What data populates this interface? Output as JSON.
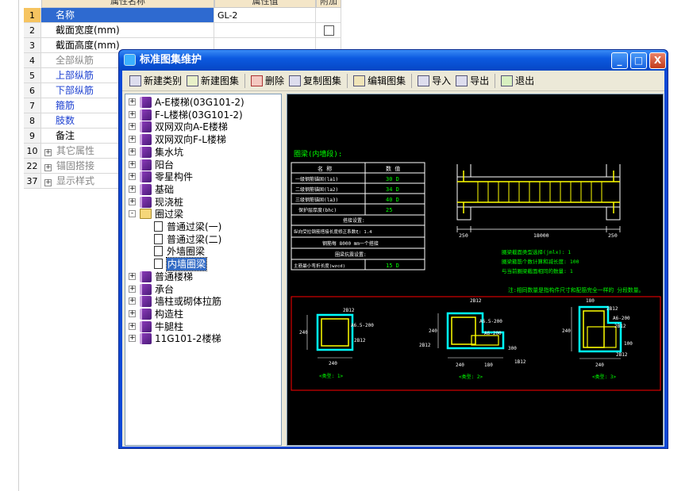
{
  "grid": {
    "headers": {
      "name": "属性名称",
      "value": "属性值",
      "add": "附加"
    },
    "rows": [
      {
        "num": "1",
        "name": "名称",
        "value": "GL-2",
        "style": "sel"
      },
      {
        "num": "2",
        "name": "截面宽度(mm)",
        "value": "",
        "style": "",
        "check": true
      },
      {
        "num": "3",
        "name": "截面高度(mm)",
        "value": "",
        "style": ""
      },
      {
        "num": "4",
        "name": "全部纵筋",
        "value": "",
        "style": "gray"
      },
      {
        "num": "5",
        "name": "上部纵筋",
        "value": "",
        "style": "blue"
      },
      {
        "num": "6",
        "name": "下部纵筋",
        "value": "",
        "style": "blue"
      },
      {
        "num": "7",
        "name": "箍筋",
        "value": "",
        "style": "blue"
      },
      {
        "num": "8",
        "name": "肢数",
        "value": "",
        "style": "blue"
      },
      {
        "num": "9",
        "name": "备注",
        "value": "",
        "style": ""
      },
      {
        "num": "10",
        "name": "其它属性",
        "value": "",
        "style": "gray",
        "expand": "+"
      },
      {
        "num": "22",
        "name": "锚固搭接",
        "value": "",
        "style": "gray",
        "expand": "+"
      },
      {
        "num": "37",
        "name": "显示样式",
        "value": "",
        "style": "gray",
        "expand": "+"
      }
    ]
  },
  "dialog": {
    "title": "标准图集维护",
    "controls": {
      "minimize": "_",
      "maximize": "□",
      "close": "X"
    },
    "toolbar": {
      "new_category": "新建类别",
      "new_atlas": "新建图集",
      "delete": "删除",
      "copy_atlas": "复制图集",
      "edit_atlas": "编辑图集",
      "import": "导入",
      "export": "导出",
      "exit": "退出"
    },
    "tree": [
      {
        "label": "A-E楼梯(03G101-2)",
        "type": "book",
        "pm": "+"
      },
      {
        "label": "F-L楼梯(03G101-2)",
        "type": "book",
        "pm": "+"
      },
      {
        "label": "双网双向A-E楼梯",
        "type": "book",
        "pm": "+"
      },
      {
        "label": "双网双向F-L楼梯",
        "type": "book",
        "pm": "+"
      },
      {
        "label": "集水坑",
        "type": "book",
        "pm": "+"
      },
      {
        "label": "阳台",
        "type": "book",
        "pm": "+"
      },
      {
        "label": "零星构件",
        "type": "book",
        "pm": "+"
      },
      {
        "label": "基础",
        "type": "book",
        "pm": "+"
      },
      {
        "label": "现浇桩",
        "type": "book",
        "pm": "+"
      },
      {
        "label": "圈过梁",
        "type": "folder",
        "pm": "-"
      },
      {
        "label": "普通过梁(一)",
        "type": "leaf"
      },
      {
        "label": "普通过梁(二)",
        "type": "leaf"
      },
      {
        "label": "外墙圈梁",
        "type": "leaf"
      },
      {
        "label": "内墙圈梁",
        "type": "leaf",
        "selected": true
      },
      {
        "label": "普通楼梯",
        "type": "book",
        "pm": "+"
      },
      {
        "label": "承台",
        "type": "book",
        "pm": "+"
      },
      {
        "label": "墙柱或砌体拉筋",
        "type": "book",
        "pm": "+"
      },
      {
        "label": "构造柱",
        "type": "book",
        "pm": "+"
      },
      {
        "label": "牛腿柱",
        "type": "book",
        "pm": "+"
      },
      {
        "label": "11G101-2楼梯",
        "type": "book",
        "pm": "+"
      }
    ],
    "drawing": {
      "heading": "圈梁(内墙段):",
      "table_head": {
        "name": "名 称",
        "value": "数 值"
      },
      "table_rows": [
        {
          "name": "一级钢筋锚固(la1)",
          "value": "30 D"
        },
        {
          "name": "二级钢筋锚固(la2)",
          "value": "34 D"
        },
        {
          "name": "三级钢筋锚固(la3)",
          "value": "40 D"
        },
        {
          "name": "保护层厚度(bhc)",
          "value": "25"
        }
      ],
      "splice_title": "搭接设置:",
      "splice_row": "纵向受拉钢筋搭接长度修正系数ξ: 1.4",
      "bar_len": "钢筋每 8000 mm一个搭接",
      "seismic_title": "圈梁抗震设置:",
      "seismic_row": {
        "name": "主筋最小弯折长度(wzcd)",
        "value": "15 D"
      },
      "dim_left": "250",
      "dim_mid": "18000",
      "dim_right": "250",
      "note1": "圈梁截面类型选择(jmlx): 1",
      "note2": "圈梁箍筋个数计算和减长度: 100",
      "note3": "与当前圈梁截面相同的数量: 1",
      "note4": "注:相同数量是指构件尺寸和配筋完全一样的 分段数量。",
      "sec1": {
        "top": "2B12",
        "stir": "A6.5-200",
        "bot": "2B12",
        "h": "240",
        "w": "240",
        "cap": "<类型: 1>"
      },
      "sec2": {
        "top": "2B12",
        "stir": "A6.5-200",
        "stir2": "A6-200",
        "left": "2B12",
        "h": "240",
        "h2": "300",
        "bot": "1B12",
        "w": "240",
        "w2": "180",
        "cap": "<类型: 2>"
      },
      "sec3": {
        "top": "2B12",
        "w1": "180",
        "stir": "A6-200",
        "mid": "2B12",
        "r": "100",
        "h": "240",
        "bot": "2B12",
        "w": "240",
        "cap": "<类型: 3>"
      }
    }
  }
}
